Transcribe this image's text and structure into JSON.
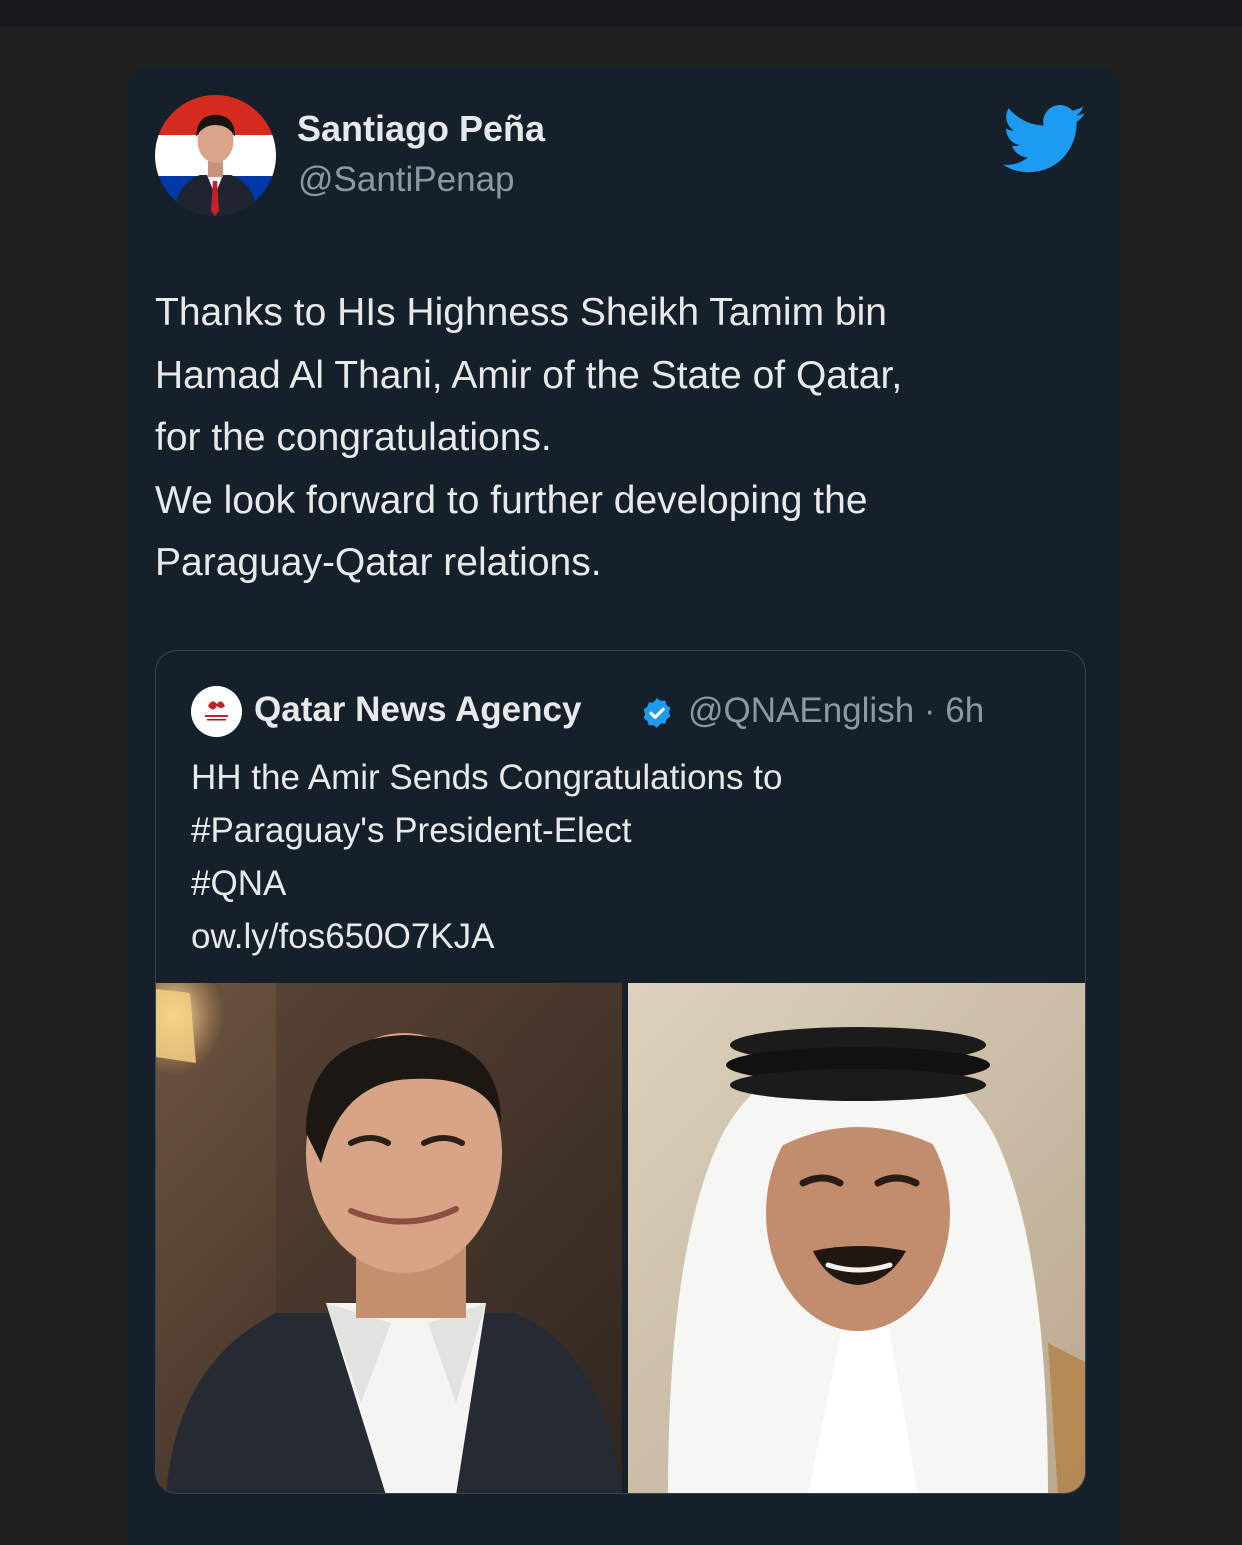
{
  "tweet": {
    "author": {
      "name": "Santiago Peña",
      "handle": "@SantiPenap"
    },
    "text_lines": [
      "Thanks to HIs Highness Sheikh Tamim bin",
      "Hamad Al Thani, Amir of the State of Qatar,",
      "for the congratulations.",
      "We look forward to further developing the",
      "Paraguay-Qatar relations."
    ]
  },
  "quoted_tweet": {
    "name": "Qatar News Agency",
    "handle_time": "@QNAEnglish · 6h",
    "text_lines": [
      "HH the Amir Sends Congratulations to",
      "#Paraguay's President-Elect",
      "#QNA",
      "ow.ly/fos650O7KJA"
    ]
  },
  "icons": {
    "brand": "twitter-bird-icon",
    "verified": "verified-badge-icon"
  },
  "colors": {
    "background": "#202020",
    "card": "#15202b",
    "text_primary": "#e7e9ea",
    "text_secondary": "#8b98a5",
    "twitter_blue": "#1d9bf0",
    "border": "#38444d"
  }
}
